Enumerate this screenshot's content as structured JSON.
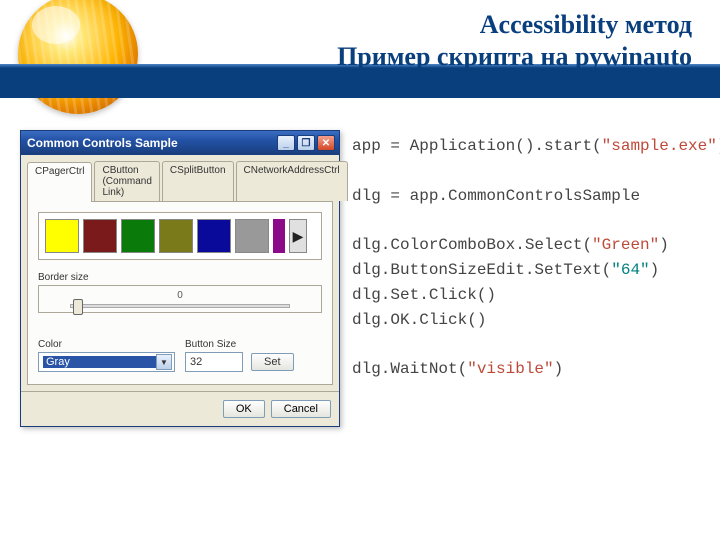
{
  "slide": {
    "title_line1": "Accessibility метод",
    "title_line2": "Пример скрипта на pywinauto"
  },
  "dialog": {
    "title": "Common Controls Sample",
    "window_buttons": {
      "min": "_",
      "max": "❐",
      "close": "✕"
    },
    "tabs": [
      {
        "label": "CPagerCtrl",
        "active": true
      },
      {
        "label": "CButton (Command Link)",
        "active": false
      },
      {
        "label": "CSplitButton",
        "active": false
      },
      {
        "label": "CNetworkAddressCtrl",
        "active": false
      }
    ],
    "swatches": [
      "#ffff00",
      "#7a1a1a",
      "#0a7a0a",
      "#7a7a1a",
      "#0a0a9a",
      "#999999"
    ],
    "minicolor": "#8a0a8a",
    "pager_next": "▶",
    "border_label": "Border size",
    "border_value": "0",
    "color_label": "Color",
    "color_value": "Gray",
    "button_size_label": "Button Size",
    "button_size_value": "32",
    "set_button": "Set",
    "ok_button": "OK",
    "cancel_button": "Cancel"
  },
  "code": {
    "l1a": "app = Application().start(",
    "l1b": "\"sample.exe\"",
    "l1c": ")",
    "l2": "",
    "l3": "dlg = app.CommonControlsSample",
    "l4": "",
    "l5a": "dlg.ColorComboBox.Select(",
    "l5b": "\"Green\"",
    "l5c": ")",
    "l6a": "dlg.ButtonSizeEdit.SetText(",
    "l6b": "\"64\"",
    "l6c": ")",
    "l7": "dlg.Set.Click()",
    "l8": "dlg.OK.Click()",
    "l9": "",
    "l10a": "dlg.WaitNot(",
    "l10b": "\"visible\"",
    "l10c": ")"
  }
}
